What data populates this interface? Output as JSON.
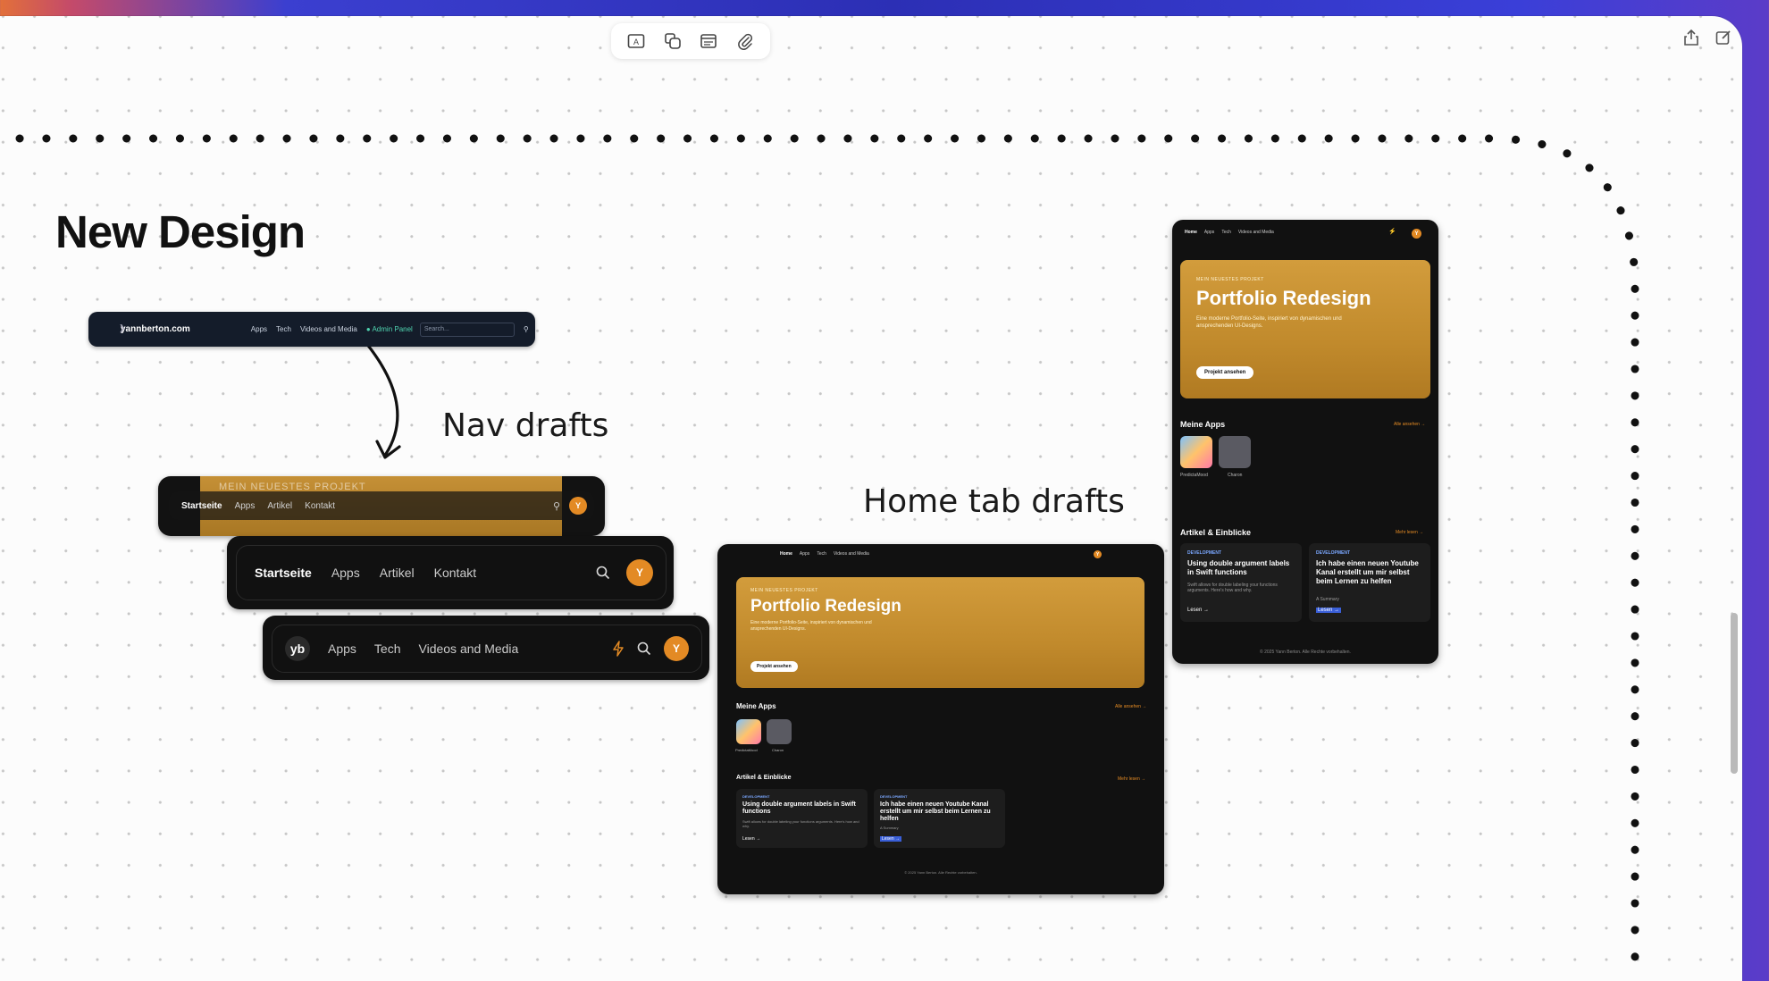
{
  "canvas": {
    "title": "New Design",
    "label_nav": "Nav drafts",
    "label_home": "Home tab drafts"
  },
  "toolbar": {
    "icons": [
      "text-box-icon",
      "shapes-icon",
      "media-icon",
      "attach-icon"
    ],
    "right": [
      "share-icon",
      "compose-icon"
    ]
  },
  "nav0": {
    "brand": "yannberton.com",
    "links": [
      "Apps",
      "Tech",
      "Videos and Media"
    ],
    "admin": "Admin Panel",
    "search_placeholder": "Search..."
  },
  "nav1": {
    "hero_text": "MEIN NEUESTES PROJEKT",
    "items": [
      "Startseite",
      "Apps",
      "Artikel",
      "Kontakt"
    ],
    "avatar": "Y"
  },
  "nav2": {
    "items": [
      "Startseite",
      "Apps",
      "Artikel",
      "Kontakt"
    ],
    "avatar": "Y"
  },
  "nav3": {
    "logo": "yb",
    "items": [
      "Apps",
      "Tech",
      "Videos and Media"
    ],
    "avatar": "Y"
  },
  "home": {
    "nav": [
      "Home",
      "Apps",
      "Tech",
      "Videos and Media"
    ],
    "avatar": "Y",
    "kicker": "MEIN NEUESTES PROJEKT",
    "hero_title": "Portfolio Redesign",
    "hero_desc": "Eine moderne Portfolio-Seite, inspiriert von dynamischen und ansprechenden UI-Designs.",
    "hero_button": "Projekt ansehen",
    "apps_title": "Meine Apps",
    "apps_link": "Alle ansehen →",
    "apps": [
      "PredictaMood",
      "Charon"
    ],
    "articles_title": "Artikel & Einblicke",
    "articles_link": "Mehr lesen →",
    "articles": [
      {
        "tag": "DEVELOPMENT",
        "title": "Using double argument labels in Swift functions",
        "desc": "Swift allows for double labeling your functions arguments. Here's how and why.",
        "cta": "Lesen →"
      },
      {
        "tag": "DEVELOPMENT",
        "title": "Ich habe einen neuen Youtube Kanal erstellt um mir selbst beim Lernen zu helfen",
        "desc": "A Summary",
        "cta": "Lesen →"
      }
    ],
    "footer": "© 2025 Yann Berton. Alle Rechte vorbehalten."
  },
  "colors": {
    "accent": "#e38a24",
    "gold": "#c8922f",
    "dark": "#111111"
  }
}
